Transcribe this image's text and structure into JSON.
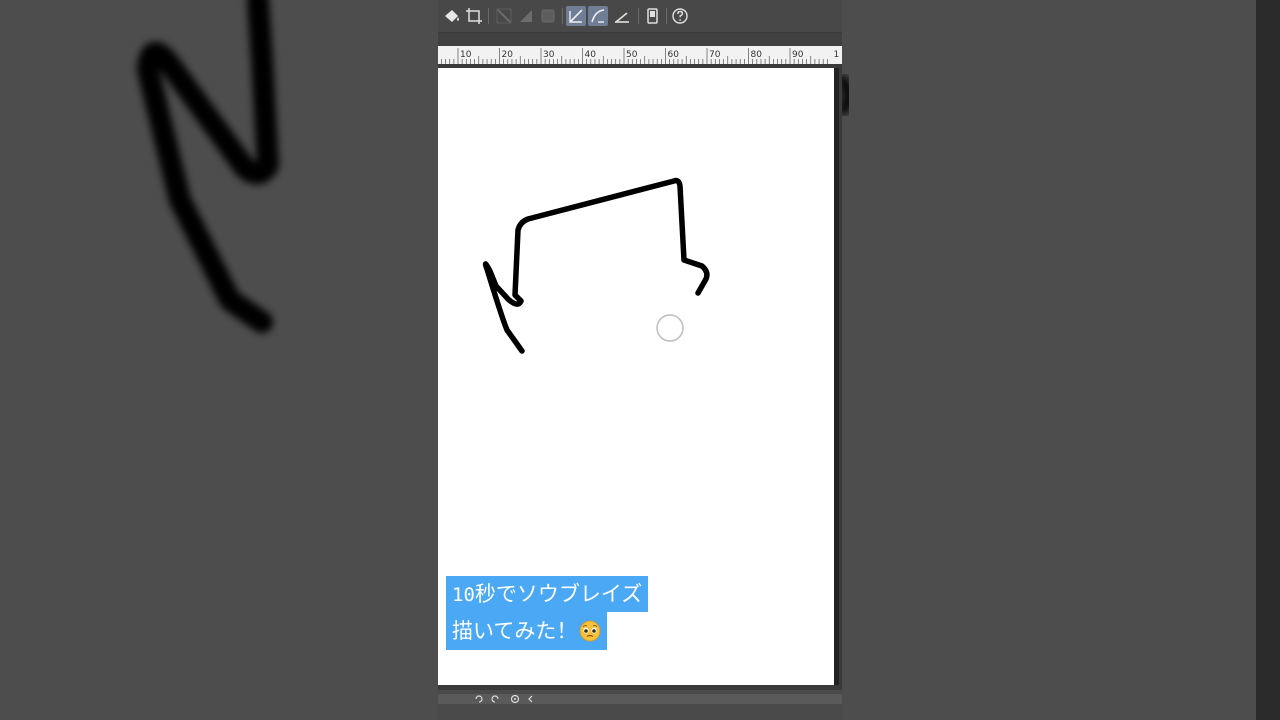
{
  "toolbar": {
    "buttons": [
      {
        "name": "fill-icon",
        "active": false
      },
      {
        "name": "transform-icon",
        "active": false
      },
      {
        "name": "snap-line-icon",
        "active": false
      },
      {
        "name": "snap-gradient-icon",
        "active": false
      },
      {
        "name": "snap-square-icon",
        "active": false
      },
      {
        "name": "ruler-line-icon",
        "active": true
      },
      {
        "name": "ruler-curve-icon",
        "active": true
      },
      {
        "name": "ruler-perspective-icon",
        "active": false
      },
      {
        "name": "device-icon",
        "active": false
      },
      {
        "name": "help-icon",
        "active": false
      }
    ],
    "active_color": "#6f7d95"
  },
  "ruler": {
    "labels": [
      "10",
      "20",
      "30",
      "40",
      "50",
      "60",
      "70",
      "80",
      "90",
      "1"
    ]
  },
  "caption": {
    "line1_number": "10",
    "line1_text": "秒でソウブレイズ",
    "line2_text": "描いてみた！",
    "emoji": "pleading-face-emoji",
    "background_color": "#4aa8f5"
  },
  "canvas": {
    "background_color": "#ffffff",
    "stroke_color": "#000000"
  },
  "bottom_bar": {
    "icons": [
      "undo-icon",
      "redo-icon",
      "rotate-icon",
      "flip-icon"
    ]
  }
}
